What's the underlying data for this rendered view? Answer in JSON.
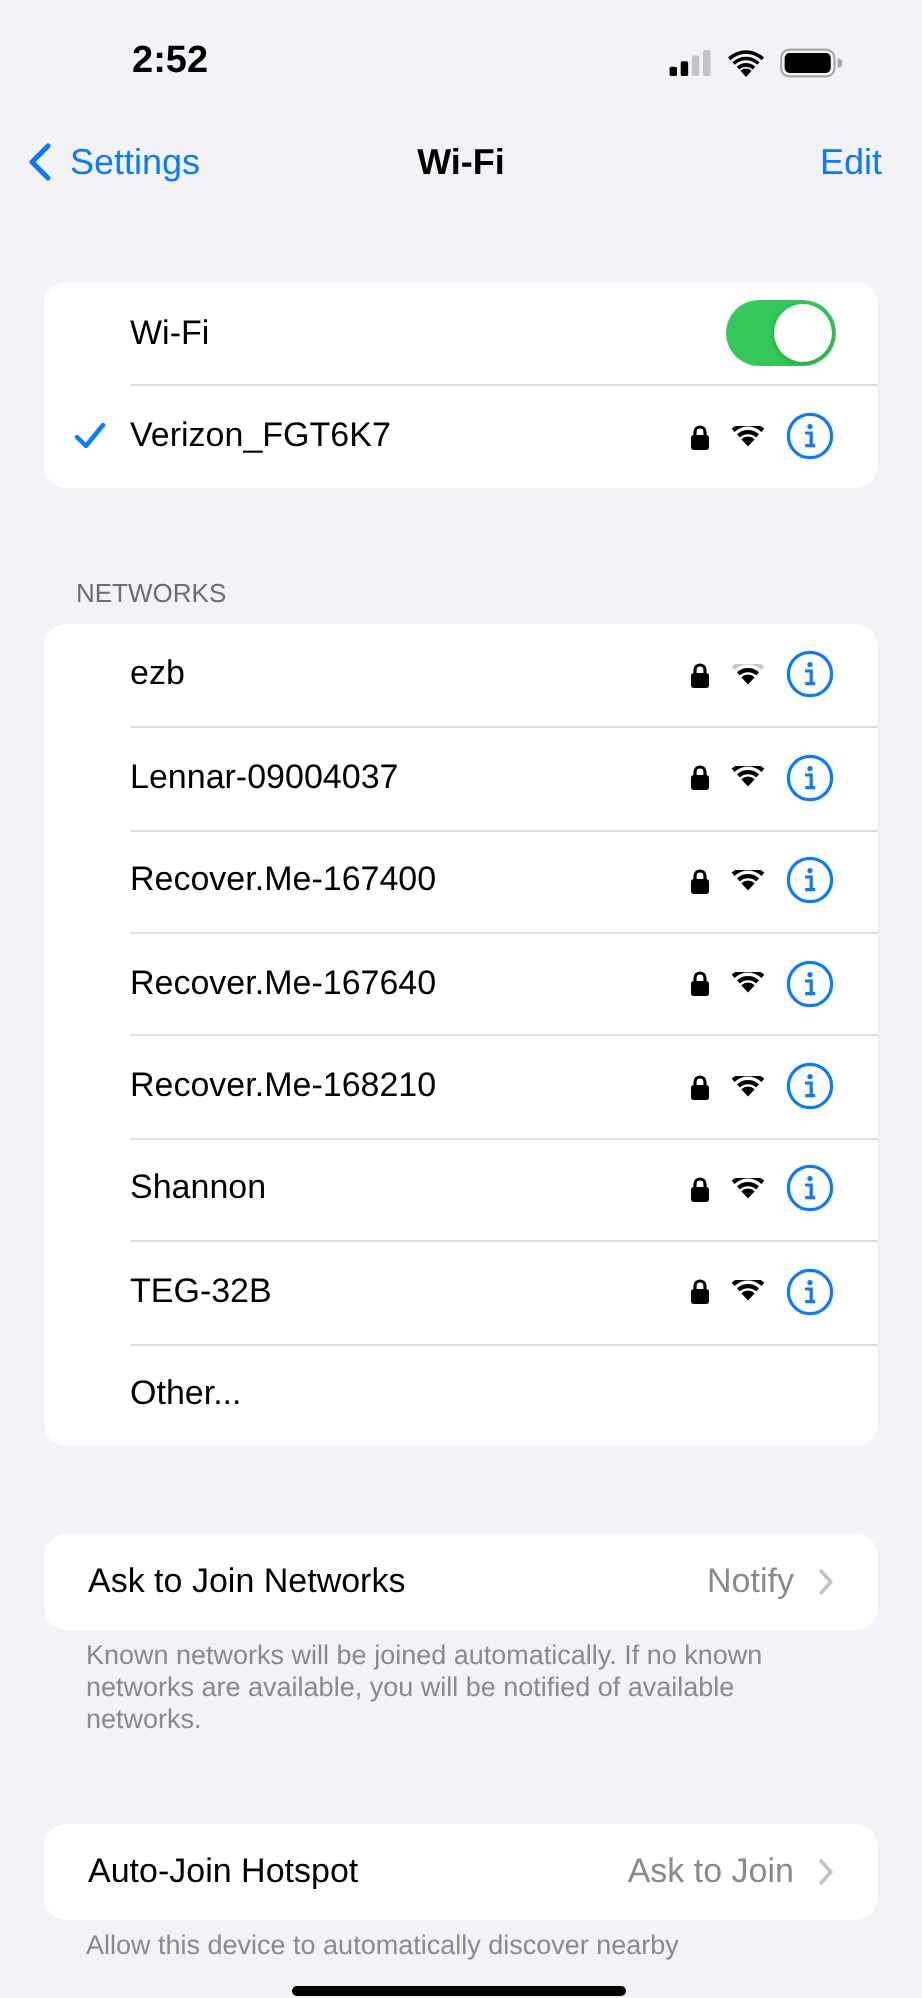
{
  "status_bar": {
    "time": "2:52"
  },
  "nav": {
    "back": "Settings",
    "title": "Wi-Fi",
    "action": "Edit"
  },
  "wifi": {
    "label": "Wi-Fi",
    "on": true,
    "connected": {
      "name": "Verizon_FGT6K7",
      "locked": true,
      "weak_signal": false
    }
  },
  "networks_header": "NETWORKS",
  "networks": [
    {
      "kind": "network",
      "name": "ezb",
      "locked": true,
      "weak_signal": true
    },
    {
      "kind": "network",
      "name": "Lennar-09004037",
      "locked": true,
      "weak_signal": false
    },
    {
      "kind": "network",
      "name": "Recover.Me-167400",
      "locked": true,
      "weak_signal": false
    },
    {
      "kind": "network",
      "name": "Recover.Me-167640",
      "locked": true,
      "weak_signal": false
    },
    {
      "kind": "network",
      "name": "Recover.Me-168210",
      "locked": true,
      "weak_signal": false
    },
    {
      "kind": "network",
      "name": "Shannon",
      "locked": true,
      "weak_signal": false
    },
    {
      "kind": "network",
      "name": "TEG-32B",
      "locked": true,
      "weak_signal": false
    },
    {
      "kind": "other",
      "name": "Other..."
    }
  ],
  "settings": [
    {
      "label": "Ask to Join Networks",
      "value": "Notify",
      "footer": "Known networks will be joined automatically. If no known networks are available, you will be notified of available networks."
    },
    {
      "label": "Auto-Join Hotspot",
      "value": "Ask to Join",
      "footer": "Allow this device to automatically discover nearby"
    }
  ]
}
